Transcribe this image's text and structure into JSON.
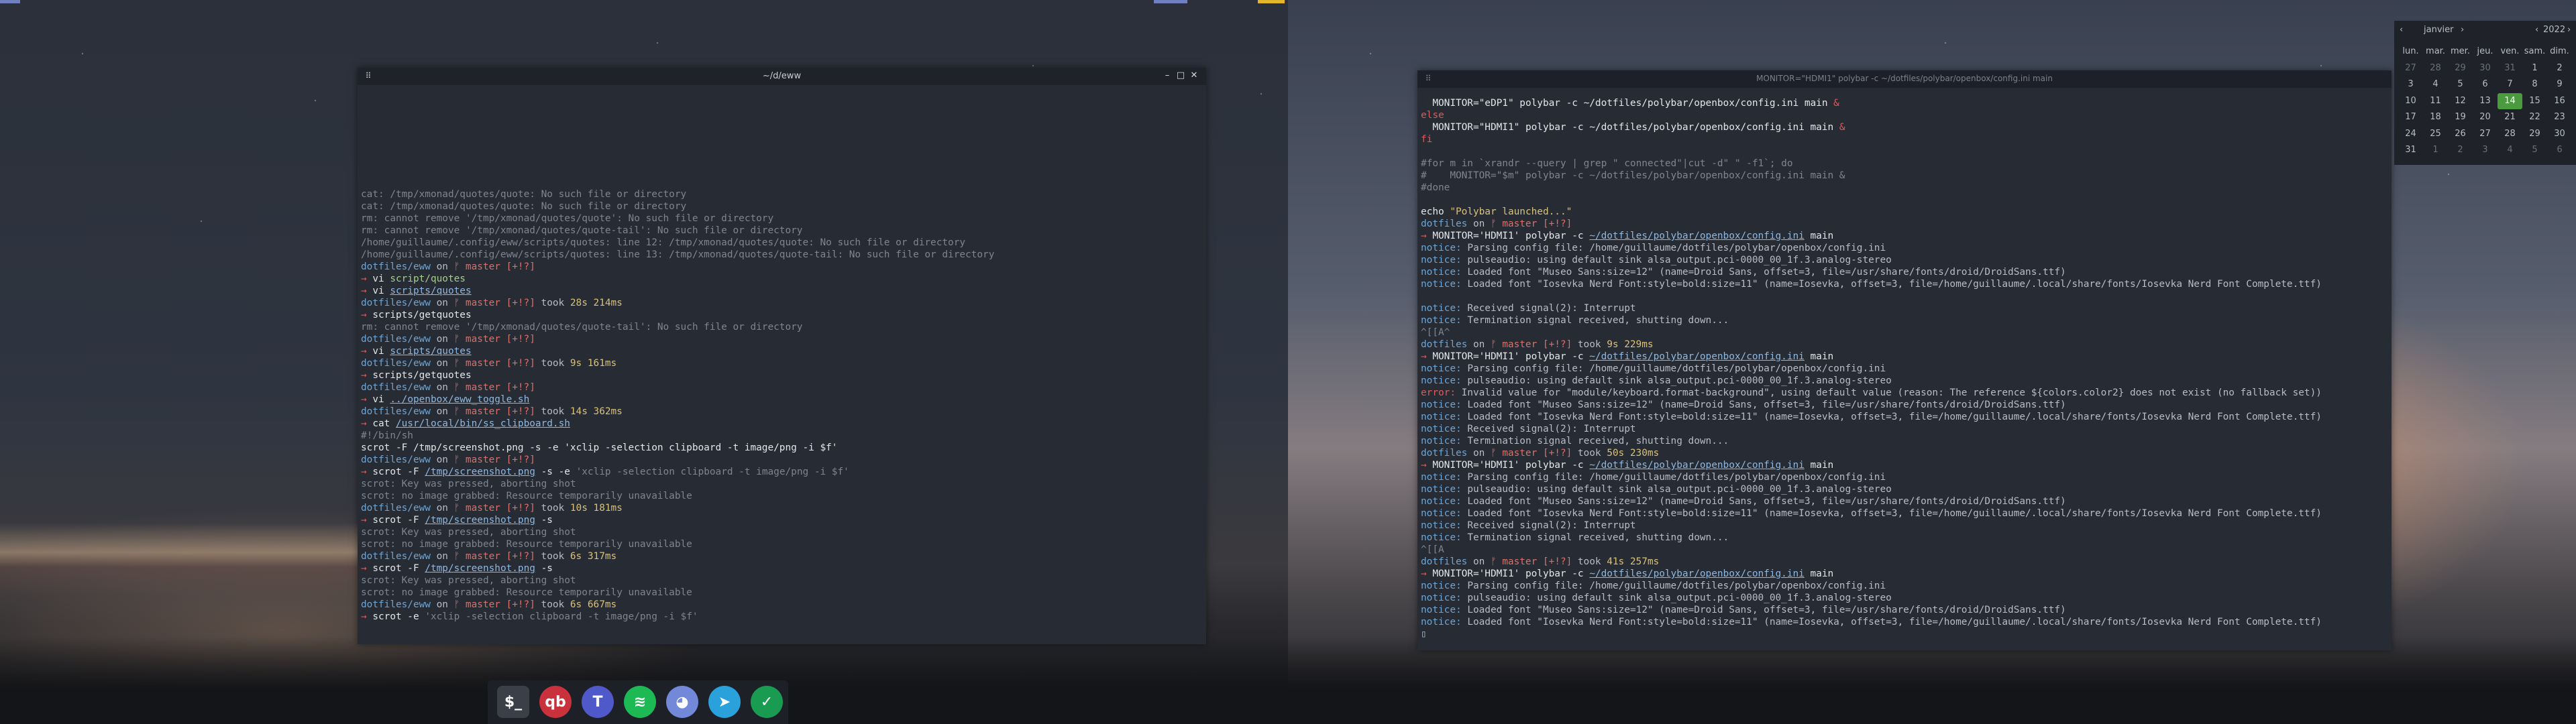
{
  "left_terminal": {
    "title": "~/d/eww",
    "menu_icon": "menu-icon",
    "lines": [
      [
        [
          "cat: /tmp/xmonad/quotes/quote: No such file or directory",
          "dim"
        ]
      ],
      [
        [
          "cat: /tmp/xmonad/quotes/quote: No such file or directory",
          "dim"
        ]
      ],
      [
        [
          "rm: cannot remove '/tmp/xmonad/quotes/quote': No such file or directory",
          "dim"
        ]
      ],
      [
        [
          "rm: cannot remove '/tmp/xmonad/quotes/quote-tail': No such file or directory",
          "dim"
        ]
      ],
      [
        [
          "/home/guillaume/.config/eww/scripts/quotes: line 12: /tmp/xmonad/quotes/quote: No such file or directory",
          "dim"
        ]
      ],
      [
        [
          "/home/guillaume/.config/eww/scripts/quotes: line 13: /tmp/xmonad/quotes/quote-tail: No such file or directory",
          "dim"
        ]
      ],
      [
        [
          "dotfiles/eww",
          "path"
        ],
        [
          " on ",
          "text"
        ],
        [
          "ᚠ master [+!?]",
          "branch"
        ]
      ],
      [
        [
          "→ ",
          "prompt"
        ],
        [
          "vi ",
          "cmd"
        ],
        [
          "script/quotes",
          "arg"
        ]
      ],
      [
        [
          "→ ",
          "prompt"
        ],
        [
          "vi ",
          "cmd"
        ],
        [
          "scripts/quotes",
          "file"
        ]
      ],
      [
        [
          "dotfiles/eww",
          "path"
        ],
        [
          " on ",
          "text"
        ],
        [
          "ᚠ master [+!?]",
          "branch"
        ],
        [
          " took ",
          "text"
        ],
        [
          "28s 214ms",
          "took"
        ]
      ],
      [
        [
          "→ ",
          "prompt"
        ],
        [
          "scripts/getquotes",
          "cmd"
        ]
      ],
      [
        [
          "rm: cannot remove '/tmp/xmonad/quotes/quote-tail': No such file or directory",
          "dim"
        ]
      ],
      [
        [
          "dotfiles/eww",
          "path"
        ],
        [
          " on ",
          "text"
        ],
        [
          "ᚠ master [+!?]",
          "branch"
        ]
      ],
      [
        [
          "→ ",
          "prompt"
        ],
        [
          "vi ",
          "cmd"
        ],
        [
          "scripts/quotes",
          "file"
        ]
      ],
      [
        [
          "dotfiles/eww",
          "path"
        ],
        [
          " on ",
          "text"
        ],
        [
          "ᚠ master [+!?]",
          "branch"
        ],
        [
          " took ",
          "text"
        ],
        [
          "9s 161ms",
          "took"
        ]
      ],
      [
        [
          "→ ",
          "prompt"
        ],
        [
          "scripts/getquotes",
          "cmd"
        ]
      ],
      [
        [
          "dotfiles/eww",
          "path"
        ],
        [
          " on ",
          "text"
        ],
        [
          "ᚠ master [+!?]",
          "branch"
        ]
      ],
      [
        [
          "→ ",
          "prompt"
        ],
        [
          "vi ",
          "cmd"
        ],
        [
          "../openbox/eww_toggle.sh",
          "file"
        ]
      ],
      [
        [
          "dotfiles/eww",
          "path"
        ],
        [
          " on ",
          "text"
        ],
        [
          "ᚠ master [+!?]",
          "branch"
        ],
        [
          " took ",
          "text"
        ],
        [
          "14s 362ms",
          "took"
        ]
      ],
      [
        [
          "→ ",
          "prompt"
        ],
        [
          "cat ",
          "cmd"
        ],
        [
          "/usr/local/bin/ss_clipboard.sh",
          "file"
        ]
      ],
      [
        [
          "#!/bin/sh",
          "dim"
        ]
      ],
      [
        [
          "scrot -F /tmp/screenshot.png -s -e 'xclip -selection clipboard -t image/png -i $f'",
          "cmd"
        ]
      ],
      [
        [
          "dotfiles/eww",
          "path"
        ],
        [
          " on ",
          "text"
        ],
        [
          "ᚠ master [+!?]",
          "branch"
        ]
      ],
      [
        [
          "→ ",
          "prompt"
        ],
        [
          "scrot -F ",
          "cmd"
        ],
        [
          "/tmp/screenshot.png",
          "file"
        ],
        [
          " -s -e ",
          "cmd"
        ],
        [
          "'xclip -selection clipboard -t image/png -i $f'",
          "dim"
        ]
      ],
      [
        [
          "scrot: Key was pressed, aborting shot",
          "dim"
        ]
      ],
      [
        [
          "scrot: no image grabbed: Resource temporarily unavailable",
          "dim"
        ]
      ],
      [
        [
          "dotfiles/eww",
          "path"
        ],
        [
          " on ",
          "text"
        ],
        [
          "ᚠ master [+!?]",
          "branch"
        ],
        [
          " took ",
          "text"
        ],
        [
          "10s 181ms",
          "took"
        ]
      ],
      [
        [
          "→ ",
          "prompt"
        ],
        [
          "scrot -F ",
          "cmd"
        ],
        [
          "/tmp/screenshot.png",
          "file"
        ],
        [
          " -s",
          "cmd"
        ]
      ],
      [
        [
          "scrot: Key was pressed, aborting shot",
          "dim"
        ]
      ],
      [
        [
          "scrot: no image grabbed: Resource temporarily unavailable",
          "dim"
        ]
      ],
      [
        [
          "dotfiles/eww",
          "path"
        ],
        [
          " on ",
          "text"
        ],
        [
          "ᚠ master [+!?]",
          "branch"
        ],
        [
          " took ",
          "text"
        ],
        [
          "6s 317ms",
          "took"
        ]
      ],
      [
        [
          "→ ",
          "prompt"
        ],
        [
          "scrot -F ",
          "cmd"
        ],
        [
          "/tmp/screenshot.png",
          "file"
        ],
        [
          " -s",
          "cmd"
        ]
      ],
      [
        [
          "scrot: Key was pressed, aborting shot",
          "dim"
        ]
      ],
      [
        [
          "scrot: no image grabbed: Resource temporarily unavailable",
          "dim"
        ]
      ],
      [
        [
          "dotfiles/eww",
          "path"
        ],
        [
          " on ",
          "text"
        ],
        [
          "ᚠ master [+!?]",
          "branch"
        ],
        [
          " took ",
          "text"
        ],
        [
          "6s 667ms",
          "took"
        ]
      ],
      [
        [
          "→ ",
          "prompt"
        ],
        [
          "scrot -e ",
          "cmd"
        ],
        [
          "'xclip -selection clipboard -t image/png -i $f'",
          "dim"
        ]
      ]
    ]
  },
  "right_terminal": {
    "title": "MONITOR=\"HDMI1\" polybar -c ~/dotfiles/polybar/openbox/config.ini main",
    "menu_icon": "menu-icon",
    "lines": [
      [
        [
          "  MONITOR=\"eDP1\" ",
          "cmd"
        ],
        [
          "polybar -c ~/dotfiles/polybar/openbox/config.ini main ",
          "cmd"
        ],
        [
          "&",
          "prompt"
        ]
      ],
      [
        [
          "else",
          "prompt"
        ]
      ],
      [
        [
          "  MONITOR=\"HDMI1\" ",
          "cmd"
        ],
        [
          "polybar -c ~/dotfiles/polybar/openbox/config.ini main ",
          "cmd"
        ],
        [
          "&",
          "prompt"
        ]
      ],
      [
        [
          "fi",
          "prompt"
        ]
      ],
      [
        [
          "",
          "text"
        ]
      ],
      [
        [
          "#for m in `xrandr --query | grep \" connected\"|cut -d\" \" -f1`; do",
          "dim"
        ]
      ],
      [
        [
          "#    MONITOR=\"$m\" polybar -c ~/dotfiles/polybar/openbox/config.ini main &",
          "dim"
        ]
      ],
      [
        [
          "#done",
          "dim"
        ]
      ],
      [
        [
          "",
          "text"
        ]
      ],
      [
        [
          "echo ",
          "cmd"
        ],
        [
          "\"Polybar launched...\"",
          "str"
        ]
      ],
      [
        [
          "dotfiles",
          "path"
        ],
        [
          " on ",
          "text"
        ],
        [
          "ᚠ master [+!?]",
          "branch"
        ]
      ],
      [
        [
          "→ ",
          "prompt"
        ],
        [
          "MONITOR='HDMI1' ",
          "cmd"
        ],
        [
          "polybar -c ",
          "cmd"
        ],
        [
          "~/dotfiles/polybar/openbox/config.ini",
          "file"
        ],
        [
          " main",
          "cmd"
        ]
      ],
      [
        [
          "notice:",
          "notice"
        ],
        [
          " Parsing config file: /home/guillaume/dotfiles/polybar/openbox/config.ini",
          "text"
        ]
      ],
      [
        [
          "notice:",
          "notice"
        ],
        [
          " pulseaudio: using default sink alsa_output.pci-0000_00_1f.3.analog-stereo",
          "text"
        ]
      ],
      [
        [
          "notice:",
          "notice"
        ],
        [
          " Loaded font \"Museo Sans:size=12\" (name=Droid Sans, offset=3, file=/usr/share/fonts/droid/DroidSans.ttf)",
          "text"
        ]
      ],
      [
        [
          "notice:",
          "notice"
        ],
        [
          " Loaded font \"Iosevka Nerd Font:style=bold:size=11\" (name=Iosevka, offset=3, file=/home/guillaume/.local/share/fonts/Iosevka Nerd Font Complete.ttf)",
          "text"
        ]
      ],
      [
        [
          "",
          "text"
        ]
      ],
      [
        [
          "notice:",
          "notice"
        ],
        [
          " Received signal(2): Interrupt",
          "text"
        ]
      ],
      [
        [
          "notice:",
          "notice"
        ],
        [
          " Termination signal received, shutting down...",
          "text"
        ]
      ],
      [
        [
          "^[[A^",
          "dim"
        ]
      ],
      [
        [
          "dotfiles",
          "path"
        ],
        [
          " on ",
          "text"
        ],
        [
          "ᚠ master [+!?]",
          "branch"
        ],
        [
          " took ",
          "text"
        ],
        [
          "9s 229ms",
          "took"
        ]
      ],
      [
        [
          "→ ",
          "prompt"
        ],
        [
          "MONITOR='HDMI1' ",
          "cmd"
        ],
        [
          "polybar -c ",
          "cmd"
        ],
        [
          "~/dotfiles/polybar/openbox/config.ini",
          "file"
        ],
        [
          " main",
          "cmd"
        ]
      ],
      [
        [
          "notice:",
          "notice"
        ],
        [
          " Parsing config file: /home/guillaume/dotfiles/polybar/openbox/config.ini",
          "text"
        ]
      ],
      [
        [
          "notice:",
          "notice"
        ],
        [
          " pulseaudio: using default sink alsa_output.pci-0000_00_1f.3.analog-stereo",
          "text"
        ]
      ],
      [
        [
          "error:",
          "error"
        ],
        [
          " Invalid value for \"module/keyboard.format-background\", using default value (reason: The reference ${colors.color2} does not exist (no fallback set))",
          "text"
        ]
      ],
      [
        [
          "notice:",
          "notice"
        ],
        [
          " Loaded font \"Museo Sans:size=12\" (name=Droid Sans, offset=3, file=/usr/share/fonts/droid/DroidSans.ttf)",
          "text"
        ]
      ],
      [
        [
          "notice:",
          "notice"
        ],
        [
          " Loaded font \"Iosevka Nerd Font:style=bold:size=11\" (name=Iosevka, offset=3, file=/home/guillaume/.local/share/fonts/Iosevka Nerd Font Complete.ttf)",
          "text"
        ]
      ],
      [
        [
          "notice:",
          "notice"
        ],
        [
          " Received signal(2): Interrupt",
          "text"
        ]
      ],
      [
        [
          "notice:",
          "notice"
        ],
        [
          " Termination signal received, shutting down...",
          "text"
        ]
      ],
      [
        [
          "dotfiles",
          "path"
        ],
        [
          " on ",
          "text"
        ],
        [
          "ᚠ master [+!?]",
          "branch"
        ],
        [
          " took ",
          "text"
        ],
        [
          "50s 230ms",
          "took"
        ]
      ],
      [
        [
          "→ ",
          "prompt"
        ],
        [
          "MONITOR='HDMI1' ",
          "cmd"
        ],
        [
          "polybar -c ",
          "cmd"
        ],
        [
          "~/dotfiles/polybar/openbox/config.ini",
          "file"
        ],
        [
          " main",
          "cmd"
        ]
      ],
      [
        [
          "notice:",
          "notice"
        ],
        [
          " Parsing config file: /home/guillaume/dotfiles/polybar/openbox/config.ini",
          "text"
        ]
      ],
      [
        [
          "notice:",
          "notice"
        ],
        [
          " pulseaudio: using default sink alsa_output.pci-0000_00_1f.3.analog-stereo",
          "text"
        ]
      ],
      [
        [
          "notice:",
          "notice"
        ],
        [
          " Loaded font \"Museo Sans:size=12\" (name=Droid Sans, offset=3, file=/usr/share/fonts/droid/DroidSans.ttf)",
          "text"
        ]
      ],
      [
        [
          "notice:",
          "notice"
        ],
        [
          " Loaded font \"Iosevka Nerd Font:style=bold:size=11\" (name=Iosevka, offset=3, file=/home/guillaume/.local/share/fonts/Iosevka Nerd Font Complete.ttf)",
          "text"
        ]
      ],
      [
        [
          "notice:",
          "notice"
        ],
        [
          " Received signal(2): Interrupt",
          "text"
        ]
      ],
      [
        [
          "notice:",
          "notice"
        ],
        [
          " Termination signal received, shutting down...",
          "text"
        ]
      ],
      [
        [
          "^[[A",
          "dim"
        ]
      ],
      [
        [
          "dotfiles",
          "path"
        ],
        [
          " on ",
          "text"
        ],
        [
          "ᚠ master [+!?]",
          "branch"
        ],
        [
          " took ",
          "text"
        ],
        [
          "41s 257ms",
          "took"
        ]
      ],
      [
        [
          "→ ",
          "prompt"
        ],
        [
          "MONITOR='HDMI1' ",
          "cmd"
        ],
        [
          "polybar -c ",
          "cmd"
        ],
        [
          "~/dotfiles/polybar/openbox/config.ini",
          "file"
        ],
        [
          " main",
          "cmd"
        ]
      ],
      [
        [
          "notice:",
          "notice"
        ],
        [
          " Parsing config file: /home/guillaume/dotfiles/polybar/openbox/config.ini",
          "text"
        ]
      ],
      [
        [
          "notice:",
          "notice"
        ],
        [
          " pulseaudio: using default sink alsa_output.pci-0000_00_1f.3.analog-stereo",
          "text"
        ]
      ],
      [
        [
          "notice:",
          "notice"
        ],
        [
          " Loaded font \"Museo Sans:size=12\" (name=Droid Sans, offset=3, file=/usr/share/fonts/droid/DroidSans.ttf)",
          "text"
        ]
      ],
      [
        [
          "notice:",
          "notice"
        ],
        [
          " Loaded font \"Iosevka Nerd Font:style=bold:size=11\" (name=Iosevka, offset=3, file=/home/guillaume/.local/share/fonts/Iosevka Nerd Font Complete.ttf)",
          "text"
        ]
      ],
      [
        [
          "▯",
          "text"
        ]
      ]
    ]
  },
  "calendar": {
    "month": "janvier",
    "year": "2022",
    "prev_month_icon": "‹",
    "next_month_icon": "›",
    "prev_year_icon": "‹",
    "next_year_icon": "›",
    "weekdays": [
      "lun.",
      "mar.",
      "mer.",
      "jeu.",
      "ven.",
      "sam.",
      "dim."
    ],
    "weeks": [
      [
        "27",
        "28",
        "29",
        "30",
        "31",
        "1",
        "2"
      ],
      [
        "3",
        "4",
        "5",
        "6",
        "7",
        "8",
        "9"
      ],
      [
        "10",
        "11",
        "12",
        "13",
        "14",
        "15",
        "16"
      ],
      [
        "17",
        "18",
        "19",
        "20",
        "21",
        "22",
        "23"
      ],
      [
        "24",
        "25",
        "26",
        "27",
        "28",
        "29",
        "30"
      ],
      [
        "31",
        "1",
        "2",
        "3",
        "4",
        "5",
        "6"
      ]
    ],
    "today": "14",
    "today_color": "#4a9a3e"
  },
  "dock": {
    "items": [
      {
        "name": "terminal",
        "icon": "terminal-icon",
        "glyph": "$_",
        "color": "#3b3f47"
      },
      {
        "name": "qbittorrent",
        "icon": "qbittorrent-icon",
        "glyph": "qb",
        "color": "#c9313d"
      },
      {
        "name": "teams",
        "icon": "teams-icon",
        "glyph": "T",
        "color": "#5059c9"
      },
      {
        "name": "spotify",
        "icon": "spotify-icon",
        "glyph": "≋",
        "color": "#1db954"
      },
      {
        "name": "discord",
        "icon": "discord-icon",
        "glyph": "◕",
        "color": "#7289da"
      },
      {
        "name": "telegram",
        "icon": "telegram-icon",
        "glyph": "➤",
        "color": "#2aa1da"
      },
      {
        "name": "vpn-shield",
        "icon": "shield-check-icon",
        "glyph": "✓",
        "color": "#1a9b52"
      }
    ]
  },
  "colors": {
    "workspace_indicator_blue": "#6f7fc0",
    "workspace_indicator_yellow": "#e2b628"
  }
}
